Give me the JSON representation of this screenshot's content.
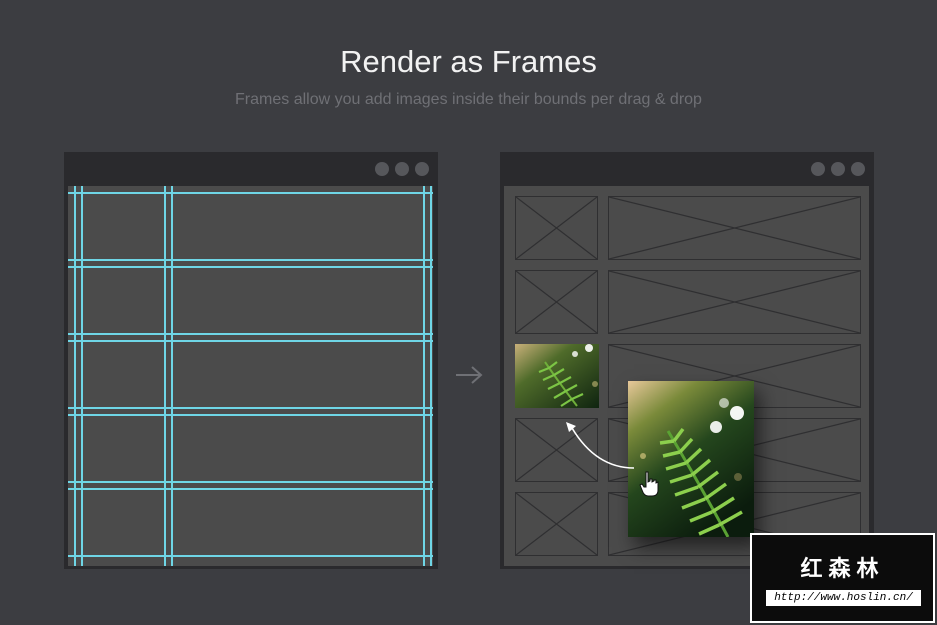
{
  "header": {
    "title": "Render as Frames",
    "subtitle": "Frames allow you add images inside their bounds per drag & drop"
  },
  "watermark": {
    "chinese_text": "红森林",
    "url": "http://www.hoslin.cn/"
  },
  "colors": {
    "background": "#3c3d41",
    "window": "#2a2a2d",
    "canvas": "#4b4b4b",
    "guide": "#6fd6e6",
    "frame_stroke": "#2f2f31"
  },
  "icons": {
    "window_controls": "three-dot-icon",
    "arrow": "right-arrow-icon",
    "cursor": "hand-pointer-icon"
  }
}
